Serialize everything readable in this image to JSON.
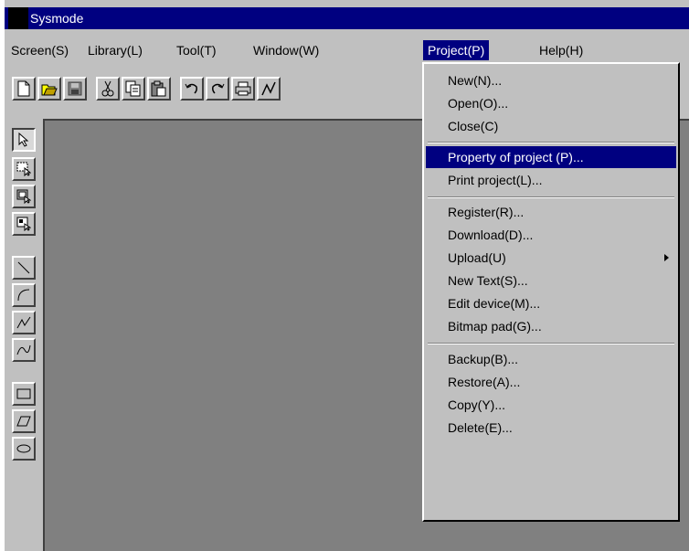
{
  "window": {
    "title": "Sysmode"
  },
  "menubar": {
    "items": [
      {
        "label": "Screen(S)"
      },
      {
        "label": "Library(L)"
      },
      {
        "label": "Tool(T)"
      },
      {
        "label": "Window(W)"
      },
      {
        "label": "Project(P)"
      },
      {
        "label": "Help(H)"
      }
    ]
  },
  "project_menu": {
    "items": [
      {
        "label": "New(N)..."
      },
      {
        "label": "Open(O)..."
      },
      {
        "label": "Close(C)"
      },
      {
        "label": "Property of project (P)..."
      },
      {
        "label": "Print project(L)..."
      },
      {
        "label": "Register(R)..."
      },
      {
        "label": "Download(D)..."
      },
      {
        "label": "Upload(U)"
      },
      {
        "label": "New Text(S)..."
      },
      {
        "label": "Edit device(M)..."
      },
      {
        "label": "Bitmap pad(G)..."
      },
      {
        "label": "Backup(B)..."
      },
      {
        "label": "Restore(A)..."
      },
      {
        "label": "Copy(Y)..."
      },
      {
        "label": "Delete(E)..."
      }
    ],
    "highlighted": "Property of project (P)..."
  },
  "toolbar": {
    "buttons": [
      "new-file-icon",
      "open-folder-icon",
      "save-disk-icon",
      "cut-scissors-icon",
      "copy-icon",
      "paste-icon",
      "undo-icon",
      "redo-icon",
      "print-icon",
      "draw-line-icon"
    ]
  },
  "palette": {
    "tools": [
      "select-arrow-icon",
      "select-area-icon",
      "select-object-icon",
      "select-group-icon",
      "line-icon",
      "arc-icon",
      "polyline-icon",
      "curve-icon",
      "rectangle-icon",
      "parallelogram-icon",
      "ellipse-icon"
    ]
  },
  "colors": {
    "titlebar": "#000080",
    "highlight": "#000080",
    "face": "#c0c0c0",
    "workspace": "#808080"
  }
}
